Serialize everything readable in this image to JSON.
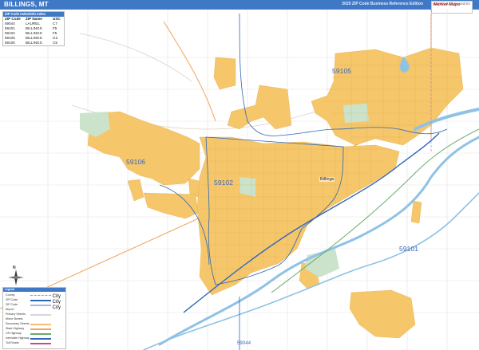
{
  "header": {
    "title": "BILLINGS, MT",
    "subtitle": "2025 ZIP Code Business Reference Edition",
    "logo_text": "Market Maps",
    "logo_small": "MAPS\nSALES\nBUSINESS"
  },
  "zip_table": {
    "header": "ZIP Code Index/Info Index",
    "columns": [
      "ZIP Code",
      "ZIP Name",
      "USC"
    ],
    "rows": [
      {
        "zip": "59044",
        "name": "LAUREL",
        "usc": "C7"
      },
      {
        "zip": "59101",
        "name": "BILLINGS",
        "usc": "F5"
      },
      {
        "zip": "59102",
        "name": "BILLINGS",
        "usc": "F5"
      },
      {
        "zip": "59105",
        "name": "BILLINGS",
        "usc": "G2"
      },
      {
        "zip": "59106",
        "name": "BILLINGS",
        "usc": "C5"
      }
    ]
  },
  "zip_labels": [
    {
      "text": "59105"
    },
    {
      "text": "59106"
    },
    {
      "text": "59102"
    },
    {
      "text": "59101"
    },
    {
      "text": "59044"
    }
  ],
  "city_label": "Billings",
  "legend": {
    "header": "Legend",
    "items": [
      "County",
      "ZIP Code",
      "ZIP Code",
      "Airport",
      "Primary Streets",
      "Minor Streets",
      "Secondary Streets",
      "State Highway",
      "US Highway",
      "Interstate Highway",
      "Toll Roads"
    ],
    "city_examples": [
      "City",
      "City",
      "City"
    ]
  },
  "compass_label": "N",
  "colors": {
    "header": "#3f79c6",
    "city_fill": "#f6c66a",
    "water": "#8fc2e4",
    "zip_boundary": "#2f67b8",
    "park": "#cbe3cb"
  }
}
